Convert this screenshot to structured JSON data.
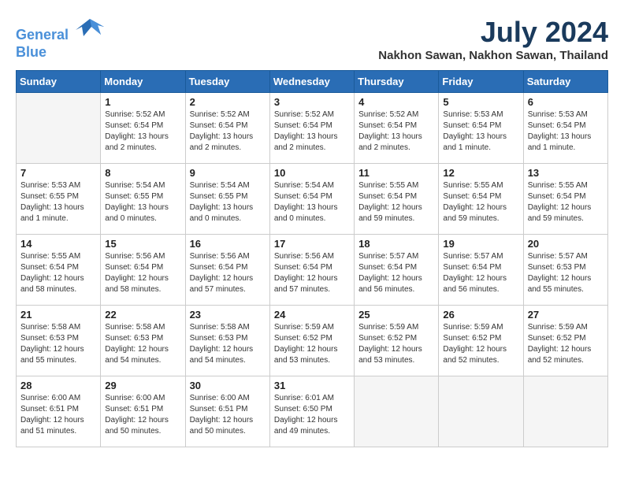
{
  "header": {
    "logo_line1": "General",
    "logo_line2": "Blue",
    "month_year": "July 2024",
    "location": "Nakhon Sawan, Nakhon Sawan, Thailand"
  },
  "weekdays": [
    "Sunday",
    "Monday",
    "Tuesday",
    "Wednesday",
    "Thursday",
    "Friday",
    "Saturday"
  ],
  "weeks": [
    [
      {
        "day": "",
        "empty": true
      },
      {
        "day": "1",
        "sunrise": "Sunrise: 5:52 AM",
        "sunset": "Sunset: 6:54 PM",
        "daylight": "Daylight: 13 hours and 2 minutes."
      },
      {
        "day": "2",
        "sunrise": "Sunrise: 5:52 AM",
        "sunset": "Sunset: 6:54 PM",
        "daylight": "Daylight: 13 hours and 2 minutes."
      },
      {
        "day": "3",
        "sunrise": "Sunrise: 5:52 AM",
        "sunset": "Sunset: 6:54 PM",
        "daylight": "Daylight: 13 hours and 2 minutes."
      },
      {
        "day": "4",
        "sunrise": "Sunrise: 5:52 AM",
        "sunset": "Sunset: 6:54 PM",
        "daylight": "Daylight: 13 hours and 2 minutes."
      },
      {
        "day": "5",
        "sunrise": "Sunrise: 5:53 AM",
        "sunset": "Sunset: 6:54 PM",
        "daylight": "Daylight: 13 hours and 1 minute."
      },
      {
        "day": "6",
        "sunrise": "Sunrise: 5:53 AM",
        "sunset": "Sunset: 6:54 PM",
        "daylight": "Daylight: 13 hours and 1 minute."
      }
    ],
    [
      {
        "day": "7",
        "sunrise": "Sunrise: 5:53 AM",
        "sunset": "Sunset: 6:55 PM",
        "daylight": "Daylight: 13 hours and 1 minute."
      },
      {
        "day": "8",
        "sunrise": "Sunrise: 5:54 AM",
        "sunset": "Sunset: 6:55 PM",
        "daylight": "Daylight: 13 hours and 0 minutes."
      },
      {
        "day": "9",
        "sunrise": "Sunrise: 5:54 AM",
        "sunset": "Sunset: 6:55 PM",
        "daylight": "Daylight: 13 hours and 0 minutes."
      },
      {
        "day": "10",
        "sunrise": "Sunrise: 5:54 AM",
        "sunset": "Sunset: 6:54 PM",
        "daylight": "Daylight: 13 hours and 0 minutes."
      },
      {
        "day": "11",
        "sunrise": "Sunrise: 5:55 AM",
        "sunset": "Sunset: 6:54 PM",
        "daylight": "Daylight: 12 hours and 59 minutes."
      },
      {
        "day": "12",
        "sunrise": "Sunrise: 5:55 AM",
        "sunset": "Sunset: 6:54 PM",
        "daylight": "Daylight: 12 hours and 59 minutes."
      },
      {
        "day": "13",
        "sunrise": "Sunrise: 5:55 AM",
        "sunset": "Sunset: 6:54 PM",
        "daylight": "Daylight: 12 hours and 59 minutes."
      }
    ],
    [
      {
        "day": "14",
        "sunrise": "Sunrise: 5:55 AM",
        "sunset": "Sunset: 6:54 PM",
        "daylight": "Daylight: 12 hours and 58 minutes."
      },
      {
        "day": "15",
        "sunrise": "Sunrise: 5:56 AM",
        "sunset": "Sunset: 6:54 PM",
        "daylight": "Daylight: 12 hours and 58 minutes."
      },
      {
        "day": "16",
        "sunrise": "Sunrise: 5:56 AM",
        "sunset": "Sunset: 6:54 PM",
        "daylight": "Daylight: 12 hours and 57 minutes."
      },
      {
        "day": "17",
        "sunrise": "Sunrise: 5:56 AM",
        "sunset": "Sunset: 6:54 PM",
        "daylight": "Daylight: 12 hours and 57 minutes."
      },
      {
        "day": "18",
        "sunrise": "Sunrise: 5:57 AM",
        "sunset": "Sunset: 6:54 PM",
        "daylight": "Daylight: 12 hours and 56 minutes."
      },
      {
        "day": "19",
        "sunrise": "Sunrise: 5:57 AM",
        "sunset": "Sunset: 6:54 PM",
        "daylight": "Daylight: 12 hours and 56 minutes."
      },
      {
        "day": "20",
        "sunrise": "Sunrise: 5:57 AM",
        "sunset": "Sunset: 6:53 PM",
        "daylight": "Daylight: 12 hours and 55 minutes."
      }
    ],
    [
      {
        "day": "21",
        "sunrise": "Sunrise: 5:58 AM",
        "sunset": "Sunset: 6:53 PM",
        "daylight": "Daylight: 12 hours and 55 minutes."
      },
      {
        "day": "22",
        "sunrise": "Sunrise: 5:58 AM",
        "sunset": "Sunset: 6:53 PM",
        "daylight": "Daylight: 12 hours and 54 minutes."
      },
      {
        "day": "23",
        "sunrise": "Sunrise: 5:58 AM",
        "sunset": "Sunset: 6:53 PM",
        "daylight": "Daylight: 12 hours and 54 minutes."
      },
      {
        "day": "24",
        "sunrise": "Sunrise: 5:59 AM",
        "sunset": "Sunset: 6:52 PM",
        "daylight": "Daylight: 12 hours and 53 minutes."
      },
      {
        "day": "25",
        "sunrise": "Sunrise: 5:59 AM",
        "sunset": "Sunset: 6:52 PM",
        "daylight": "Daylight: 12 hours and 53 minutes."
      },
      {
        "day": "26",
        "sunrise": "Sunrise: 5:59 AM",
        "sunset": "Sunset: 6:52 PM",
        "daylight": "Daylight: 12 hours and 52 minutes."
      },
      {
        "day": "27",
        "sunrise": "Sunrise: 5:59 AM",
        "sunset": "Sunset: 6:52 PM",
        "daylight": "Daylight: 12 hours and 52 minutes."
      }
    ],
    [
      {
        "day": "28",
        "sunrise": "Sunrise: 6:00 AM",
        "sunset": "Sunset: 6:51 PM",
        "daylight": "Daylight: 12 hours and 51 minutes."
      },
      {
        "day": "29",
        "sunrise": "Sunrise: 6:00 AM",
        "sunset": "Sunset: 6:51 PM",
        "daylight": "Daylight: 12 hours and 50 minutes."
      },
      {
        "day": "30",
        "sunrise": "Sunrise: 6:00 AM",
        "sunset": "Sunset: 6:51 PM",
        "daylight": "Daylight: 12 hours and 50 minutes."
      },
      {
        "day": "31",
        "sunrise": "Sunrise: 6:01 AM",
        "sunset": "Sunset: 6:50 PM",
        "daylight": "Daylight: 12 hours and 49 minutes."
      },
      {
        "day": "",
        "empty": true
      },
      {
        "day": "",
        "empty": true
      },
      {
        "day": "",
        "empty": true
      }
    ]
  ]
}
